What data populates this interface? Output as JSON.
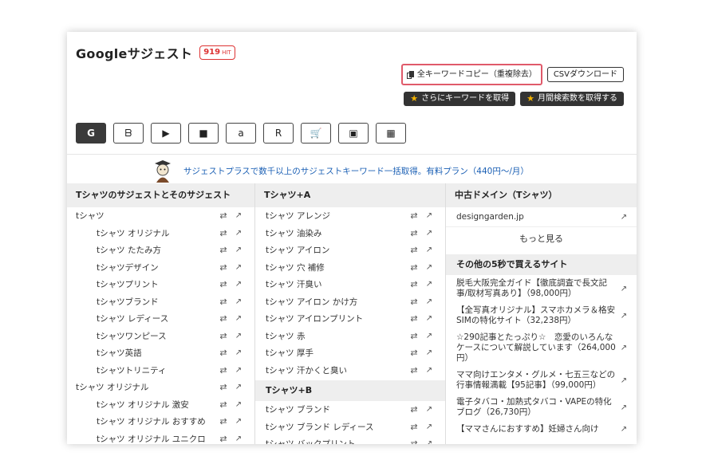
{
  "header": {
    "title": "Googleサジェスト",
    "hit_count": "919",
    "hit_unit": "HIT"
  },
  "actions": {
    "copy_all": "全キーワードコピー（重複除去）",
    "csv_download": "CSVダウンロード",
    "more_keywords": "さらにキーワードを取得",
    "monthly_volume": "月間検索数を取得する"
  },
  "engines": [
    {
      "name": "google",
      "glyph": "G"
    },
    {
      "name": "bing",
      "glyph": "ᗷ"
    },
    {
      "name": "youtube",
      "glyph": "▶"
    },
    {
      "name": "video",
      "glyph": "■"
    },
    {
      "name": "amazon",
      "glyph": "a"
    },
    {
      "name": "rakuten",
      "glyph": "R"
    },
    {
      "name": "shopping",
      "glyph": "🛒"
    },
    {
      "name": "image",
      "glyph": "▣"
    },
    {
      "name": "apps",
      "glyph": "▦"
    }
  ],
  "promo": {
    "text": "サジェストプラスで数千以上のサジェストキーワード一括取得。有料プラン（440円〜/月）"
  },
  "col1": {
    "heading": "Tシャツのサジェストとそのサジェスト",
    "rows": [
      {
        "label": "tシャツ",
        "level": 0
      },
      {
        "label": "tシャツ オリジナル",
        "level": 1
      },
      {
        "label": "tシャツ たたみ方",
        "level": 1
      },
      {
        "label": "tシャツデザイン",
        "level": 1
      },
      {
        "label": "tシャツプリント",
        "level": 1
      },
      {
        "label": "tシャツブランド",
        "level": 1
      },
      {
        "label": "tシャツ レディース",
        "level": 1
      },
      {
        "label": "tシャツワンピース",
        "level": 1
      },
      {
        "label": "tシャツ英語",
        "level": 1
      },
      {
        "label": "tシャツトリニティ",
        "level": 1
      },
      {
        "label": "tシャツ オリジナル",
        "level": 0
      },
      {
        "label": "tシャツ オリジナル 激安",
        "level": 1
      },
      {
        "label": "tシャツ オリジナル おすすめ",
        "level": 1
      },
      {
        "label": "tシャツ オリジナル ユニクロ",
        "level": 1
      }
    ]
  },
  "col2": {
    "heading": "Tシャツ+A",
    "rows": [
      "tシャツ アレンジ",
      "tシャツ 油染み",
      "tシャツ アイロン",
      "tシャツ 穴 補修",
      "tシャツ 汗臭い",
      "tシャツ アイロン かけ方",
      "tシャツ アイロンプリント",
      "tシャツ 赤",
      "tシャツ 厚手",
      "tシャツ 汗かくと臭い"
    ],
    "heading2": "Tシャツ+B",
    "rows2": [
      "tシャツ ブランド",
      "tシャツ ブランド レディース",
      "tシャツ バックプリント"
    ]
  },
  "col3": {
    "heading": "中古ドメイン（Tシャツ）",
    "domain": "designgarden.jp",
    "more": "もっと見る",
    "heading2": "その他の5秒で買えるサイト",
    "sites": [
      "脱毛大阪完全ガイド【徹底調査で長文記事/取材写真あり】（98,000円）",
      "【全写真オリジナル】スマホカメラ＆格安SIMの特化サイト（32,238円）",
      "☆290記事とたっぷり☆　恋愛のいろんなケースについて解説しています（264,000円）",
      "ママ向けエンタメ・グルメ・七五三などの行事情報満載【95記事】（99,000円）",
      "電子タバコ・加熱式タバコ・VAPEの特化ブログ（26,730円）",
      "【ママさんにおすすめ】妊婦さん向け"
    ]
  },
  "colors": {
    "accent": "#e05a6a",
    "link": "#1a5fb4",
    "dark": "#333333"
  }
}
